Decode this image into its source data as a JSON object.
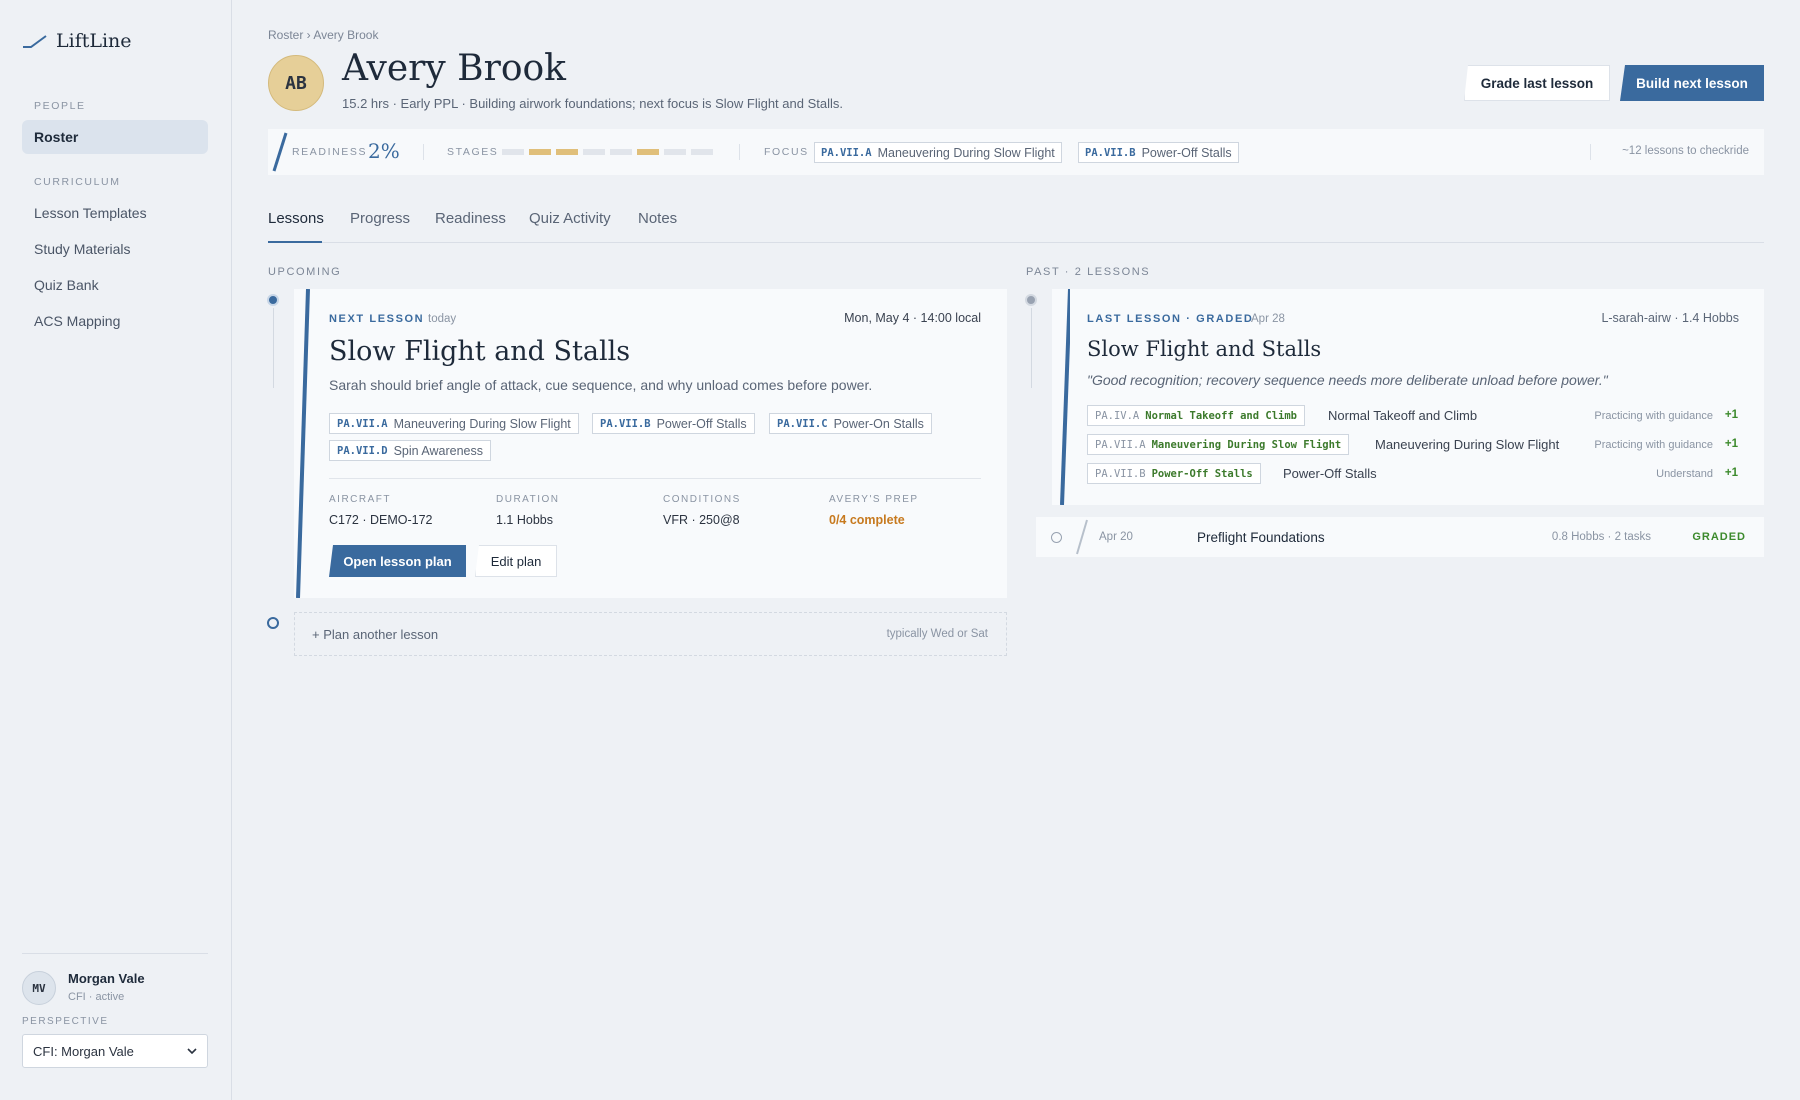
{
  "sidebar": {
    "brand": "LiftLine",
    "sections": [
      {
        "title": "PEOPLE",
        "items": [
          {
            "label": "Roster",
            "active": true
          }
        ]
      },
      {
        "title": "CURRICULUM",
        "items": [
          {
            "label": "Lesson Templates"
          },
          {
            "label": "Study Materials"
          },
          {
            "label": "Quiz Bank"
          },
          {
            "label": "ACS Mapping"
          }
        ]
      }
    ],
    "user": {
      "initials": "MV",
      "name": "Morgan Vale",
      "role": "CFI · active"
    },
    "perspective": {
      "label": "PERSPECTIVE",
      "selected": "CFI: Morgan Vale"
    }
  },
  "header": {
    "breadcrumb": "Roster › Avery Brook",
    "avatar_initials": "AB",
    "student_name": "Avery Brook",
    "subtitle": "15.2 hrs · Early PPL · Building airwork foundations; next focus is Slow Flight and Stalls.",
    "grade_button": "Grade last lesson",
    "build_button": "Build next lesson"
  },
  "strip": {
    "readiness_label": "READINESS",
    "readiness_value": "2%",
    "stages_label": "STAGES",
    "stages": [
      false,
      true,
      true,
      false,
      false,
      true,
      false,
      false
    ],
    "focus_label": "FOCUS",
    "focus": [
      {
        "code": "PA.VII.A",
        "name": "Maneuvering During Slow Flight"
      },
      {
        "code": "PA.VII.B",
        "name": "Power-Off Stalls"
      }
    ],
    "checkride_note": "~12 lessons to checkride"
  },
  "tabs": [
    "Lessons",
    "Progress",
    "Readiness",
    "Quiz Activity",
    "Notes"
  ],
  "upcoming": {
    "label": "UPCOMING",
    "next": {
      "kicker": "NEXT LESSON",
      "when": "today",
      "datetime": "Mon, May 4 · 14:00 local",
      "title": "Slow Flight and Stalls",
      "description": "Sarah should brief angle of attack, cue sequence, and why unload comes before power.",
      "tags": [
        {
          "code": "PA.VII.A",
          "name": "Maneuvering During Slow Flight"
        },
        {
          "code": "PA.VII.B",
          "name": "Power-Off Stalls"
        },
        {
          "code": "PA.VII.C",
          "name": "Power-On Stalls"
        },
        {
          "code": "PA.VII.D",
          "name": "Spin Awareness"
        }
      ],
      "meta": [
        {
          "label": "AIRCRAFT",
          "value": "C172 · DEMO-172"
        },
        {
          "label": "DURATION",
          "value": "1.1 Hobbs"
        },
        {
          "label": "CONDITIONS",
          "value": "VFR · 250@8"
        },
        {
          "label": "AVERY'S PREP",
          "value": "0/4 complete"
        }
      ],
      "open_button": "Open lesson plan",
      "edit_button": "Edit plan"
    },
    "plan_another": "+ Plan another lesson",
    "plan_hint": "typically Wed or Sat"
  },
  "past": {
    "label": "PAST · 2 LESSONS",
    "last": {
      "kicker": "LAST LESSON · GRADED",
      "date": "Apr 28",
      "meta": "L-sarah-airw · 1.4 Hobbs",
      "title": "Slow Flight and Stalls",
      "quote": "\"Good recognition; recovery sequence needs more deliberate unload before power.\"",
      "grades": [
        {
          "code": "PA.IV.A",
          "name": "Normal Takeoff and Climb",
          "desc": "Normal Takeoff and Climb",
          "level": "Practicing with guidance",
          "delta": "+1"
        },
        {
          "code": "PA.VII.A",
          "name": "Maneuvering During Slow Flight",
          "desc": "Maneuvering During Slow Flight",
          "level": "Practicing with guidance",
          "delta": "+1"
        },
        {
          "code": "PA.VII.B",
          "name": "Power-Off Stalls",
          "desc": "Power-Off Stalls",
          "level": "Understand",
          "delta": "+1"
        }
      ]
    },
    "older": {
      "date": "Apr 20",
      "title": "Preflight Foundations",
      "meta": "0.8 Hobbs · 2 tasks",
      "status": "GRADED"
    }
  },
  "colors": {
    "accent": "#3a6a9e",
    "stage_done": "#e0bf7a",
    "warn": "#c77a1f",
    "success": "#3c8a2c"
  }
}
